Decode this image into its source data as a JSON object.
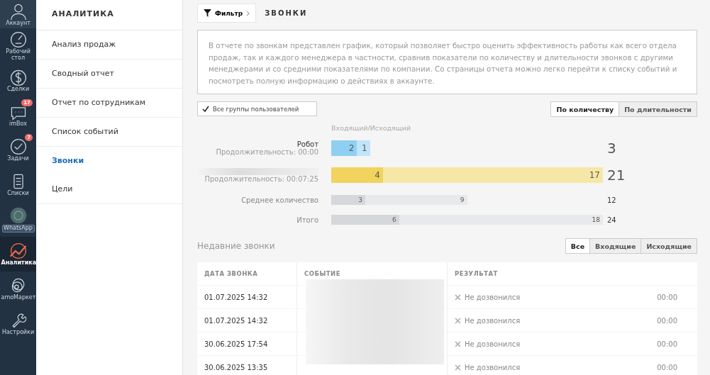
{
  "nav": [
    {
      "label": "Аккаунт",
      "selected": false
    },
    {
      "label": "Рабочий стол",
      "selected": false
    },
    {
      "label": "Сделки",
      "selected": false
    },
    {
      "label": "imBox",
      "badge": "17",
      "selected": false
    },
    {
      "label": "Задачи",
      "badge": "7",
      "selected": false
    },
    {
      "label": "Списки",
      "selected": false
    },
    {
      "label": "WhatsApp",
      "selected": false
    },
    {
      "label": "Аналитика",
      "selected": true
    },
    {
      "label": "amoМаркет",
      "selected": false
    },
    {
      "label": "Настройки",
      "selected": false
    }
  ],
  "sidebar": {
    "title": "АНАЛИТИКА",
    "items": [
      {
        "label": "Анализ продаж",
        "selected": false
      },
      {
        "label": "Сводный отчет",
        "selected": false
      },
      {
        "label": "Отчет по сотрудникам",
        "selected": false
      },
      {
        "label": "Список событий",
        "selected": false
      },
      {
        "label": "Звонки",
        "selected": true
      },
      {
        "label": "Цели",
        "selected": false
      }
    ]
  },
  "filter_button": "Фильтр",
  "page_title": "ЗВОНКИ",
  "description": "В отчете по звонкам представлен график, который позволяет быстро оценить эффективность работы как всего отдела продаж, так и каждого менеджера в частности, сравнив показатели по количеству и длительности звонков с другими менеджерами и со средними показателями по компании. Со страницы отчета можно легко перейти к списку событий и посмотреть полную информацию о действиях в аккаунте.",
  "group_filter": {
    "label": "Все группы пользователей",
    "checked": true
  },
  "mode_tabs": [
    {
      "label": "По количеству",
      "selected": true
    },
    {
      "label": "По длительности",
      "selected": false
    }
  ],
  "chart_header": "Входящий/Исходящий",
  "bars": [
    {
      "kind": "user",
      "name": "Робот",
      "duration": "Продолжительность: 00:00",
      "total": "3",
      "color": "#8fd0f2",
      "segments": [
        "2",
        "1"
      ]
    },
    {
      "kind": "user",
      "duration": "Продолжительность: 00:07:25",
      "total": "21",
      "color": "#f1d35e",
      "segments": [
        "4",
        "17"
      ]
    },
    {
      "kind": "summary",
      "name": "Среднее количество",
      "total": "12",
      "color": "#d6d7db",
      "segments": [
        "3",
        "9"
      ]
    },
    {
      "kind": "summary",
      "name": "Итого",
      "total": "24",
      "color": "#d6d7db",
      "segments": [
        "6",
        "18"
      ]
    }
  ],
  "recent": {
    "title": "Недавние звонки",
    "tabs": [
      {
        "label": "Все",
        "selected": true
      },
      {
        "label": "Входящие",
        "selected": false
      },
      {
        "label": "Исходящие",
        "selected": false
      }
    ],
    "columns": [
      "ДАТА ЗВОНКА",
      "СОБЫТИЕ",
      "РЕЗУЛЬТАТ"
    ],
    "rows": [
      {
        "date": "01.07.2025 14:32",
        "result": "Не дозвонился",
        "duration": "00:00"
      },
      {
        "date": "01.07.2025 14:32",
        "result": "Не дозвонился",
        "duration": "00:00"
      },
      {
        "date": "30.06.2025 17:54",
        "result": "Не дозвонился",
        "duration": "00:00"
      },
      {
        "date": "30.06.2025 13:35",
        "result": "Не дозвонился",
        "duration": "00:00"
      }
    ]
  }
}
